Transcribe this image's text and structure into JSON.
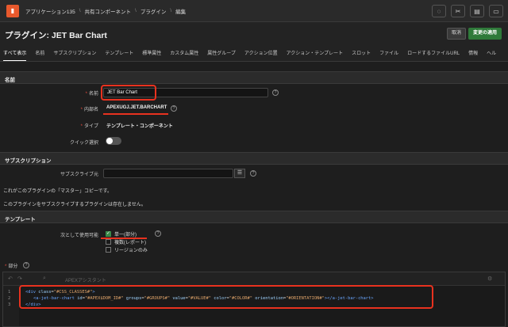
{
  "breadcrumb": {
    "app": "アプリケーション135",
    "shared": "共有コンポーネント",
    "plugins": "プラグイン",
    "edit": "編集"
  },
  "page": {
    "title": "プラグイン: JET Bar Chart",
    "cancel": "取消",
    "apply": "変更の適用"
  },
  "tabs": [
    "すべて表示",
    "名前",
    "サブスクリプション",
    "テンプレート",
    "標準属性",
    "カスタム属性",
    "属性グループ",
    "アクション位置",
    "アクション・テンプレート",
    "スロット",
    "ファイル",
    "ロードするファイルURL",
    "情報",
    "ヘル"
  ],
  "name_section": {
    "heading": "名前",
    "name_label": "名前",
    "name_value": "JET Bar Chart",
    "internal_label": "内部名",
    "internal_value": "APEXUGJ.JET.BARCHART",
    "type_label": "タイプ",
    "type_value": "テンプレート・コンポーネント",
    "quick_pick_label": "クイック選択"
  },
  "subscription_section": {
    "heading": "サブスクリプション",
    "subscribe_label": "サブスクライブ元",
    "subscribe_value": "",
    "master_note": "これがこのプラグインの「マスター」コピーです。",
    "no_subscribers": "このプラグインをサブスクライブするプラグインは存在しません。"
  },
  "template_section": {
    "heading": "テンプレート",
    "available_label": "次として使用可能",
    "options": [
      {
        "label": "単一(部分)",
        "checked": true
      },
      {
        "label": "複数(レポート)",
        "checked": false
      },
      {
        "label": "リージョンのみ",
        "checked": false
      }
    ],
    "partial_label": "部分"
  },
  "editor": {
    "assistant": "APEXアシスタント",
    "lines": [
      "1",
      "2",
      "3"
    ]
  },
  "icons": {
    "app": "app-logo-icon",
    "help": "help-icon",
    "list": "list-icon"
  },
  "colors": {
    "accent_red": "#e8321f",
    "apply_green": "#2f7a3a",
    "logo_orange": "#e8592d"
  }
}
